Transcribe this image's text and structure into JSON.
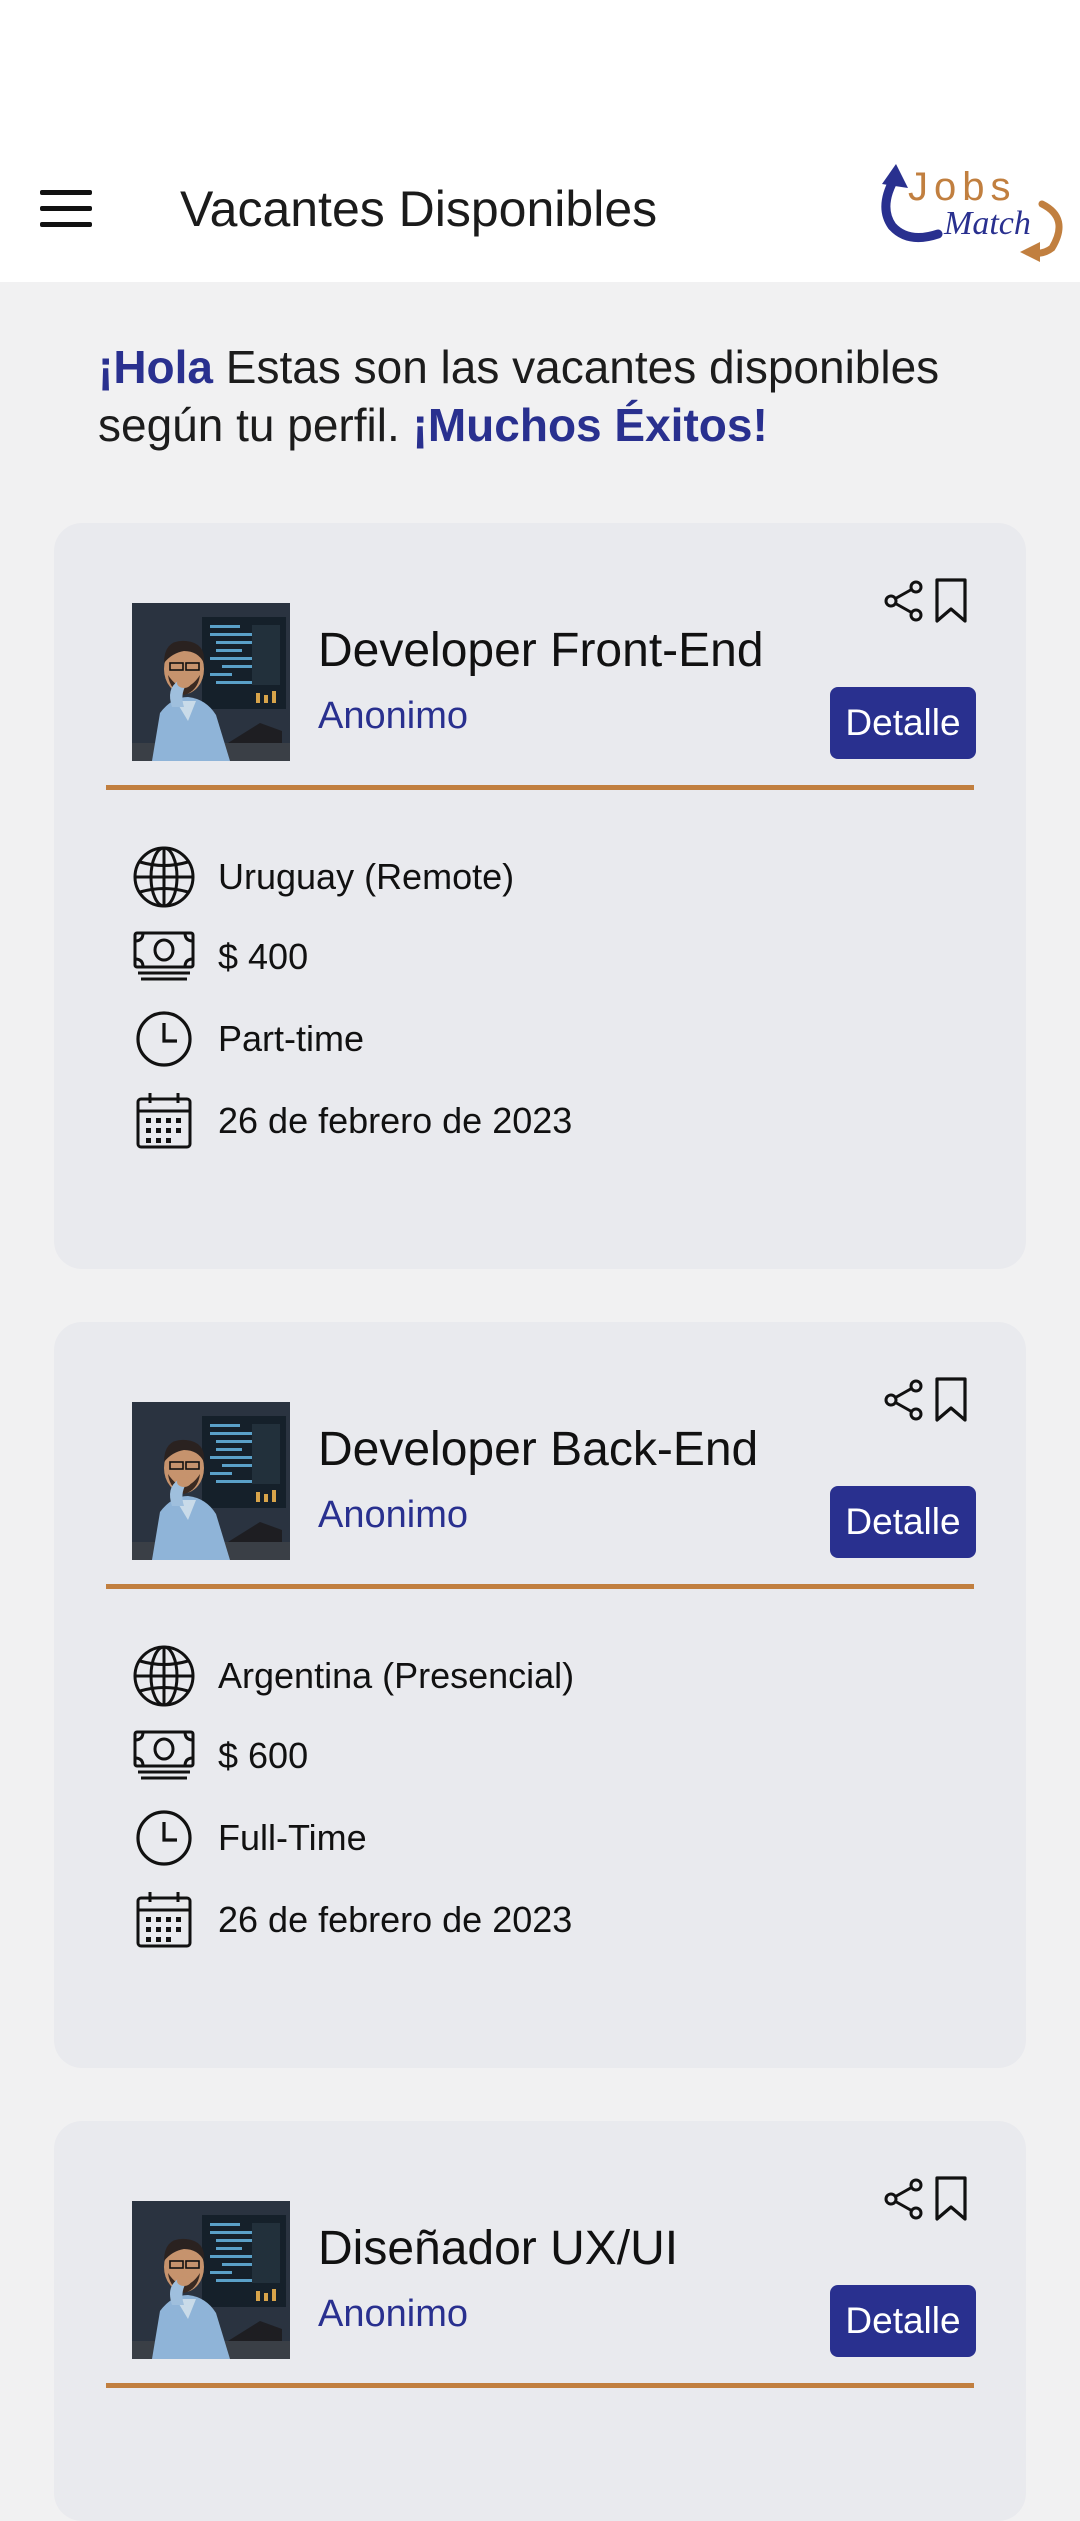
{
  "header": {
    "title": "Vacantes Disponibles",
    "logo": {
      "word1": "Jobs",
      "word2": "Match"
    },
    "menu_icon": "hamburger-menu-icon"
  },
  "intro": {
    "greeting": "¡Hola",
    "message": " Estas son las vacantes disponibles según tu perfil. ",
    "closing": "¡Muchos Éxitos!"
  },
  "colors": {
    "accent": "#29308f",
    "divider": "#c17f3f",
    "card_bg": "#e9eaee",
    "page_bg": "#f1f1f2"
  },
  "jobs": [
    {
      "title": "Developer Front-End",
      "company": "Anonimo",
      "button": "Detalle",
      "location": "Uruguay (Remote)",
      "salary": "$ 400",
      "schedule": "Part-time",
      "date": "26 de febrero de 2023"
    },
    {
      "title": "Developer Back-End",
      "company": "Anonimo",
      "button": "Detalle",
      "location": "Argentina (Presencial)",
      "salary": "$ 600",
      "schedule": "Full-Time",
      "date": "26 de febrero de 2023"
    },
    {
      "title": "Diseñador UX/UI",
      "company": "Anonimo",
      "button": "Detalle"
    }
  ]
}
